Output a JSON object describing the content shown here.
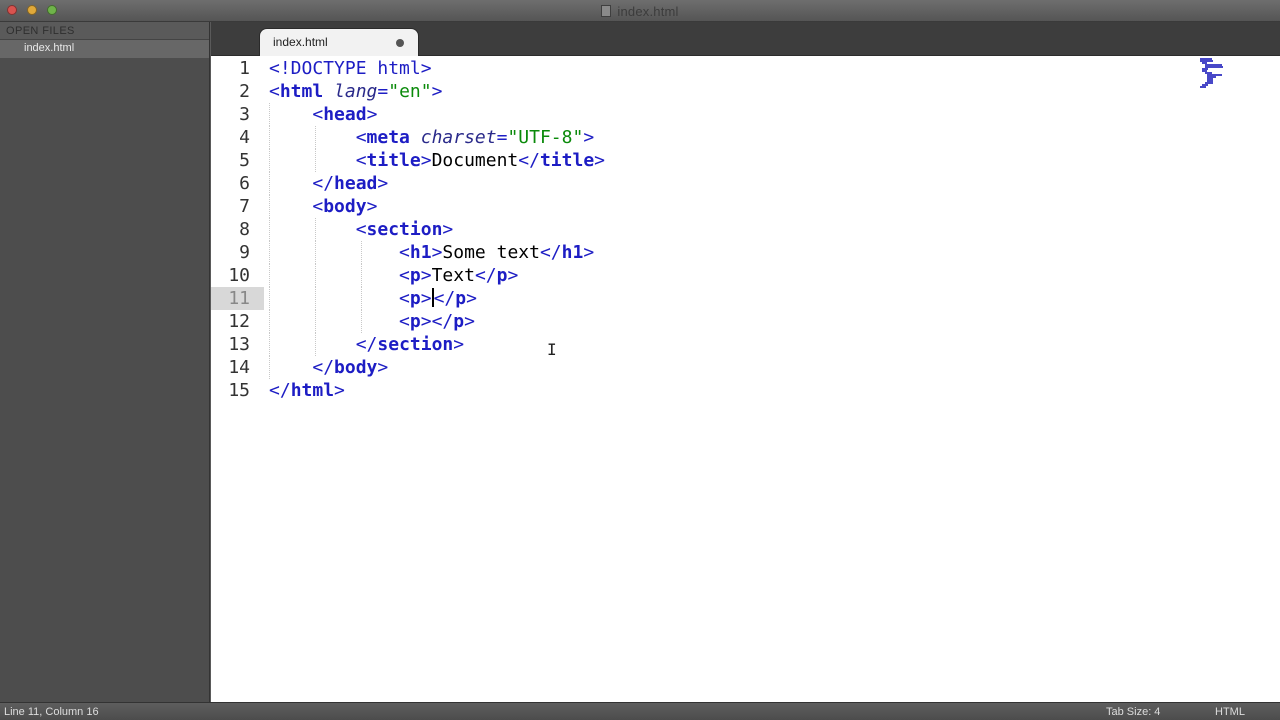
{
  "window": {
    "title": "index.html",
    "doc_icon": "document-icon"
  },
  "sidebar": {
    "header": "OPEN FILES",
    "files": [
      {
        "label": "index.html"
      }
    ]
  },
  "tabs": [
    {
      "label": "index.html",
      "dirty": true
    }
  ],
  "editor": {
    "active_line": 11,
    "line_numbers": [
      "1",
      "2",
      "3",
      "4",
      "5",
      "6",
      "7",
      "8",
      "9",
      "10",
      "11",
      "12",
      "13",
      "14",
      "15"
    ],
    "lines": [
      {
        "indent": "",
        "segments": [
          {
            "t": "<!DOCTYPE html>",
            "c": "punct"
          }
        ]
      },
      {
        "indent": "",
        "segments": [
          {
            "t": "<",
            "c": "punct"
          },
          {
            "t": "html",
            "c": "tag"
          },
          {
            "t": " ",
            "c": ""
          },
          {
            "t": "lang",
            "c": "attr"
          },
          {
            "t": "=",
            "c": "punct"
          },
          {
            "t": "\"en\"",
            "c": "str"
          },
          {
            "t": ">",
            "c": "punct"
          }
        ]
      },
      {
        "indent": "    ",
        "segments": [
          {
            "t": "<",
            "c": "punct"
          },
          {
            "t": "head",
            "c": "tag"
          },
          {
            "t": ">",
            "c": "punct"
          }
        ]
      },
      {
        "indent": "        ",
        "segments": [
          {
            "t": "<",
            "c": "punct"
          },
          {
            "t": "meta",
            "c": "tag"
          },
          {
            "t": " ",
            "c": ""
          },
          {
            "t": "charset",
            "c": "attr"
          },
          {
            "t": "=",
            "c": "punct"
          },
          {
            "t": "\"UTF-8\"",
            "c": "str"
          },
          {
            "t": ">",
            "c": "punct"
          }
        ]
      },
      {
        "indent": "        ",
        "segments": [
          {
            "t": "<",
            "c": "punct"
          },
          {
            "t": "title",
            "c": "tag"
          },
          {
            "t": ">",
            "c": "punct"
          },
          {
            "t": "Document",
            "c": ""
          },
          {
            "t": "</",
            "c": "punct"
          },
          {
            "t": "title",
            "c": "tag"
          },
          {
            "t": ">",
            "c": "punct"
          }
        ]
      },
      {
        "indent": "    ",
        "segments": [
          {
            "t": "</",
            "c": "punct"
          },
          {
            "t": "head",
            "c": "tag"
          },
          {
            "t": ">",
            "c": "punct"
          }
        ]
      },
      {
        "indent": "    ",
        "segments": [
          {
            "t": "<",
            "c": "punct"
          },
          {
            "t": "body",
            "c": "tag"
          },
          {
            "t": ">",
            "c": "punct"
          }
        ]
      },
      {
        "indent": "        ",
        "segments": [
          {
            "t": "<",
            "c": "punct"
          },
          {
            "t": "section",
            "c": "tag"
          },
          {
            "t": ">",
            "c": "punct"
          }
        ]
      },
      {
        "indent": "            ",
        "segments": [
          {
            "t": "<",
            "c": "punct"
          },
          {
            "t": "h1",
            "c": "tag"
          },
          {
            "t": ">",
            "c": "punct"
          },
          {
            "t": "Some text",
            "c": ""
          },
          {
            "t": "</",
            "c": "punct"
          },
          {
            "t": "h1",
            "c": "tag"
          },
          {
            "t": ">",
            "c": "punct"
          }
        ]
      },
      {
        "indent": "            ",
        "segments": [
          {
            "t": "<",
            "c": "punct"
          },
          {
            "t": "p",
            "c": "tag"
          },
          {
            "t": ">",
            "c": "punct"
          },
          {
            "t": "Text",
            "c": ""
          },
          {
            "t": "</",
            "c": "punct"
          },
          {
            "t": "p",
            "c": "tag"
          },
          {
            "t": ">",
            "c": "punct"
          }
        ]
      },
      {
        "indent": "            ",
        "segments": [
          {
            "t": "<",
            "c": "punct"
          },
          {
            "t": "p",
            "c": "tag"
          },
          {
            "t": ">",
            "c": "punct"
          },
          {
            "t": "",
            "c": "caret"
          },
          {
            "t": "</",
            "c": "punct"
          },
          {
            "t": "p",
            "c": "tag"
          },
          {
            "t": ">",
            "c": "punct"
          }
        ]
      },
      {
        "indent": "            ",
        "segments": [
          {
            "t": "<",
            "c": "punct"
          },
          {
            "t": "p",
            "c": "tag"
          },
          {
            "t": ">",
            "c": "punct"
          },
          {
            "t": "</",
            "c": "punct"
          },
          {
            "t": "p",
            "c": "tag"
          },
          {
            "t": ">",
            "c": "punct"
          }
        ]
      },
      {
        "indent": "        ",
        "segments": [
          {
            "t": "</",
            "c": "punct"
          },
          {
            "t": "section",
            "c": "tag"
          },
          {
            "t": ">",
            "c": "punct"
          }
        ]
      },
      {
        "indent": "    ",
        "segments": [
          {
            "t": "</",
            "c": "punct"
          },
          {
            "t": "body",
            "c": "tag"
          },
          {
            "t": ">",
            "c": "punct"
          }
        ]
      },
      {
        "indent": "",
        "segments": [
          {
            "t": "</",
            "c": "punct"
          },
          {
            "t": "html",
            "c": "tag"
          },
          {
            "t": ">",
            "c": "punct"
          }
        ]
      }
    ]
  },
  "statusbar": {
    "position": "Line 11, Column 16",
    "tab_size": "Tab Size: 4",
    "syntax": "HTML"
  },
  "colors": {
    "tag": "#1d1dc4",
    "attribute": "#2a2a8a",
    "string": "#0a8a0a",
    "text": "#000000"
  }
}
